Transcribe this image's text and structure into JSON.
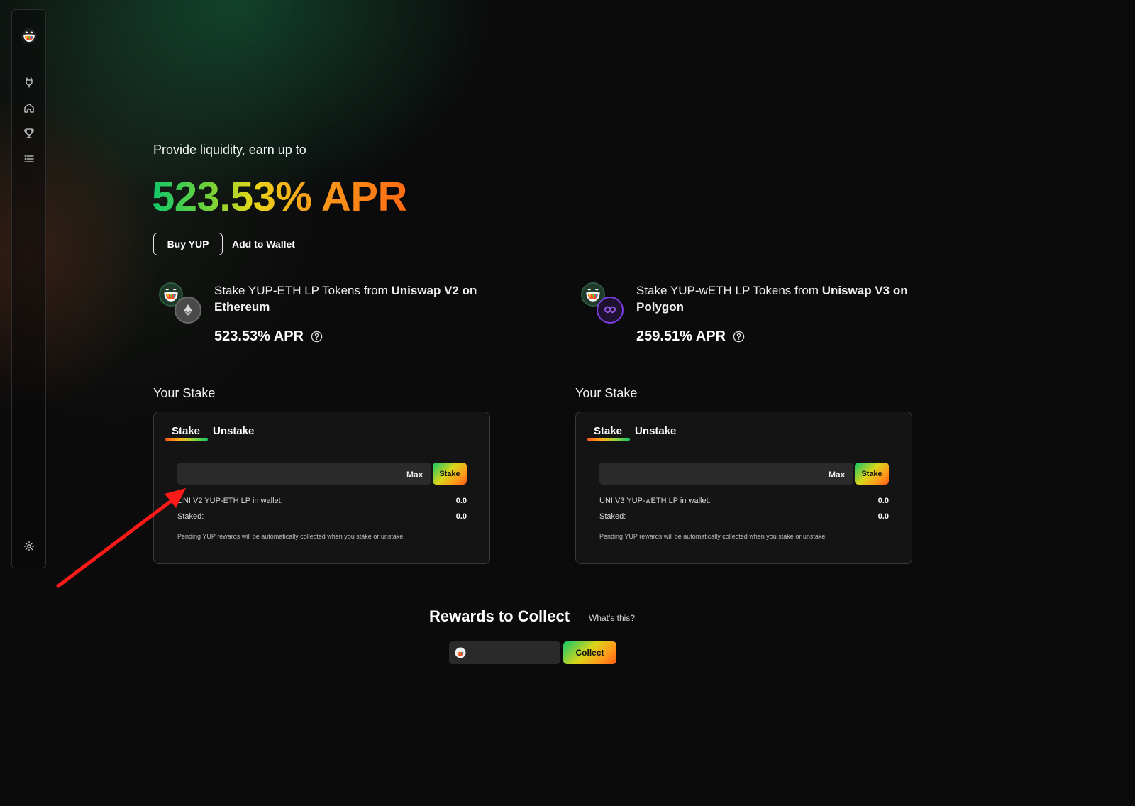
{
  "sidebar": {
    "items": [
      {
        "icon": "plug-icon"
      },
      {
        "icon": "home-icon"
      },
      {
        "icon": "trophy-icon"
      },
      {
        "icon": "list-icon"
      }
    ],
    "settings_icon": "gear-icon"
  },
  "hero": {
    "subtitle": "Provide liquidity, earn up to",
    "apr": "523.53% APR",
    "buy_label": "Buy YUP",
    "wallet_label": "Add to Wallet"
  },
  "pools": [
    {
      "title_prefix": "Stake YUP-ETH LP Tokens from ",
      "title_bold": "Uniswap V2 on Ethereum",
      "apr": "523.53% APR",
      "chain_icon": "ethereum-icon",
      "stake_heading": "Your Stake",
      "tab_stake": "Stake",
      "tab_unstake": "Unstake",
      "max_label": "Max",
      "stake_button": "Stake",
      "wallet_label": "UNI V2 YUP-ETH LP in wallet:",
      "wallet_value": "0.0",
      "staked_label": "Staked:",
      "staked_value": "0.0",
      "note": "Pending YUP rewards will be automatically collected when you stake or unstake."
    },
    {
      "title_prefix": "Stake YUP-wETH LP Tokens from ",
      "title_bold": "Uniswap V3 on Polygon",
      "apr": "259.51% APR",
      "chain_icon": "polygon-icon",
      "stake_heading": "Your Stake",
      "tab_stake": "Stake",
      "tab_unstake": "Unstake",
      "max_label": "Max",
      "stake_button": "Stake",
      "wallet_label": "UNI V3 YUP-wETH LP in wallet:",
      "wallet_value": "0.0",
      "staked_label": "Staked:",
      "staked_value": "0.0",
      "note": "Pending YUP rewards will be automatically collected when you stake or unstake."
    }
  ],
  "rewards": {
    "title": "Rewards to Collect",
    "whats_this": "What's this?",
    "collect_label": "Collect"
  },
  "colors": {
    "background": "#0b0b0b",
    "card": "#141414",
    "input": "#2a2a2a",
    "accent_green": "#12c76a",
    "accent_yellow": "#e9d71a",
    "accent_orange": "#ff6a14",
    "annotation_arrow": "#ff1a1a"
  }
}
